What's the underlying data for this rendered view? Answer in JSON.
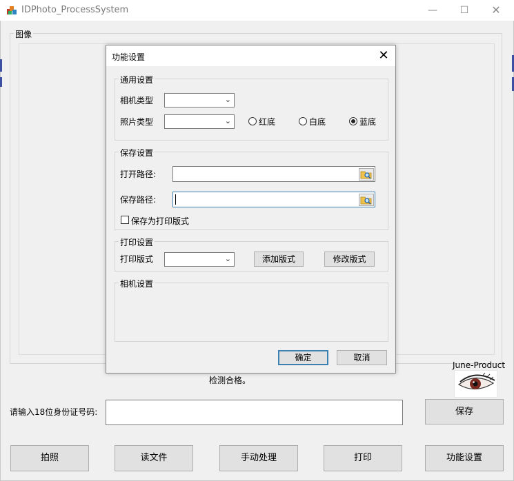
{
  "window": {
    "title": "IDPhoto_ProcessSystem",
    "minimize": "—",
    "maximize": "☐",
    "close": "✕"
  },
  "main": {
    "image_group_label": "图像",
    "status_text": "检测合格。",
    "brand_text": "June-Product",
    "id_label": "请输入18位身份证号码:",
    "id_value": "",
    "save_button": "保存",
    "buttons": [
      "拍照",
      "读文件",
      "手动处理",
      "打印",
      "功能设置"
    ]
  },
  "dialog": {
    "title": "功能设置",
    "close": "✕",
    "general": {
      "label": "通用设置",
      "camera_type_label": "相机类型",
      "camera_type_value": "",
      "photo_type_label": "照片类型",
      "photo_type_value": "",
      "radios": [
        {
          "label": "红底",
          "checked": false
        },
        {
          "label": "白底",
          "checked": false
        },
        {
          "label": "蓝底",
          "checked": true
        }
      ]
    },
    "save": {
      "label": "保存设置",
      "open_path_label": "打开路径:",
      "open_path_value": "",
      "save_path_label": "保存路径:",
      "save_path_value": "",
      "print_format_checkbox": "保存为打印版式",
      "print_format_checked": false
    },
    "print": {
      "label": "打印设置",
      "format_label": "打印版式",
      "format_value": "",
      "add_button": "添加版式",
      "edit_button": "修改版式"
    },
    "camera": {
      "label": "相机设置"
    },
    "ok_button": "确定",
    "cancel_button": "取消"
  }
}
